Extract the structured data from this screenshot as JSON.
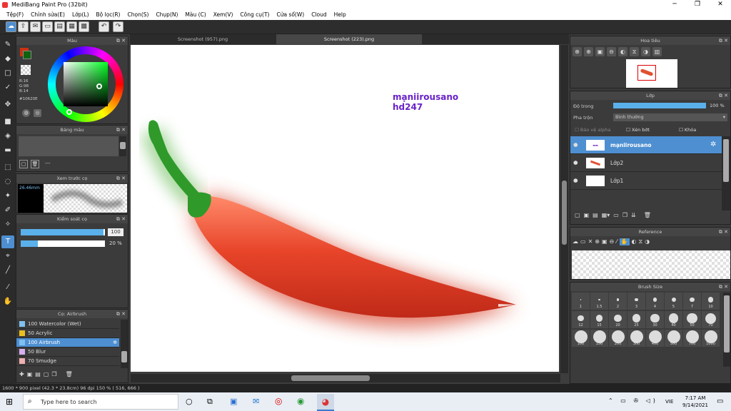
{
  "window": {
    "title": "MediBang Paint Pro (32bit)"
  },
  "menu": [
    "Tệp(F)",
    "Chỉnh sửa(E)",
    "Lớp(L)",
    "Bộ lọc(R)",
    "Chọn(S)",
    "Chụp(N)",
    "Màu (C)",
    "Xem(V)",
    "Công cụ(T)",
    "Cửa sổ(W)",
    "Cloud",
    "Help"
  ],
  "panels": {
    "color": {
      "title": "Màu",
      "r": "R:16",
      "g": "G:98",
      "b": "B:14",
      "hex": "#10620E",
      "accent": "#10620E"
    },
    "palette": {
      "title": "Bảng màu",
      "empty": "---"
    },
    "brush_preview": {
      "title": "Xem trước cọ",
      "size": "26.46mm"
    },
    "brush_control": {
      "title": "Kiểm soát cọ",
      "size_value": "100",
      "opacity_value": "20 %",
      "size_fraction": 0.98,
      "opacity_fraction": 0.2
    },
    "brush_list": {
      "title": "Cọ: Airbrush",
      "items": [
        {
          "size": "100",
          "name": "Watercolor (Wet)",
          "color": "#7fc0f0"
        },
        {
          "size": "50",
          "name": "Acrylic",
          "color": "#e8c020"
        },
        {
          "size": "100",
          "name": "Airbrush",
          "color": "#7fc0f0"
        },
        {
          "size": "50",
          "name": "Blur",
          "color": "#d8b0f0"
        },
        {
          "size": "70",
          "name": "Smudge",
          "color": "#f0b0b0"
        }
      ]
    },
    "navigator": {
      "title": "Hoa tiêu"
    },
    "layers": {
      "title": "Lớp",
      "opacity_label": "Độ trong",
      "opacity_value": "100 %",
      "blend_label": "Pha trộn",
      "blend_value": "Bình thường",
      "protect_alpha": "Bảo vệ alpha",
      "clipping": "Xén bớt",
      "lock": "Khóa",
      "items": [
        {
          "name": "mạniirousano"
        },
        {
          "name": "Lớp2"
        },
        {
          "name": "Lớp1"
        }
      ]
    },
    "reference": {
      "title": "Reference"
    },
    "brush_size": {
      "title": "Brush Size",
      "rows": [
        [
          "1",
          "1.5",
          "2",
          "3",
          "4",
          "5",
          "7",
          "10"
        ],
        [
          "12",
          "15",
          "20",
          "25",
          "30",
          "40",
          "50",
          "70"
        ],
        [
          "100",
          "150",
          "200",
          "300",
          "400",
          "500",
          "700",
          "1000"
        ]
      ]
    }
  },
  "tabs": [
    "Screenshot (957).png",
    "Screenshot (223).png"
  ],
  "canvas": {
    "text_line1": "mạniirousano",
    "text_line2": "hd247",
    "text_color": "#6a22c8"
  },
  "status": "1600 * 900 pixel   (42.3 * 23.8cm)   96 dpi   150 %   ( 516, 666 )",
  "taskbar": {
    "search_placeholder": "Type here to search",
    "lang": "VIE",
    "time": "7:17 AM",
    "date": "9/14/2021"
  }
}
